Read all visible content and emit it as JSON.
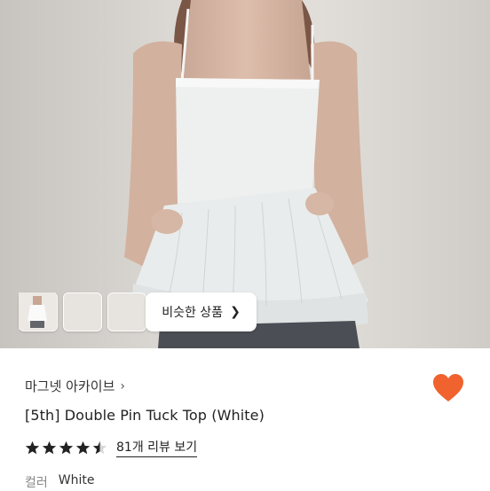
{
  "gallery": {
    "similar_button_label": "비슷한 상품",
    "thumbnail_count": 3
  },
  "product": {
    "shop_name": "마그넷 아카이브",
    "title": "[5th] Double Pin Tuck Top (White)",
    "rating": 4.5,
    "review_link": "81개 리뷰 보기",
    "color_label": "컬러",
    "color_value": "White"
  },
  "colors": {
    "heart": "#f0622e",
    "star": "#222222"
  },
  "icons": {
    "heart": "heart-icon",
    "chevron": "chevron-right-icon",
    "star": "star-icon"
  }
}
